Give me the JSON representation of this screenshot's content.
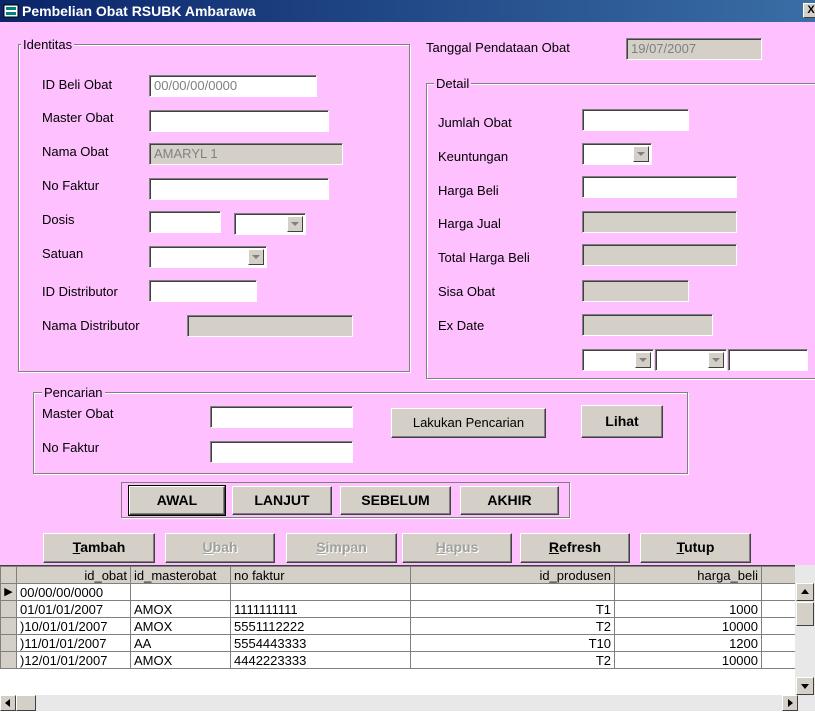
{
  "window": {
    "title": "Pembelian Obat RSUBK Ambarawa",
    "close_glyph": "X"
  },
  "identitas": {
    "group_label": "Identitas",
    "id_beli_label": "ID Beli Obat",
    "id_beli_value": "00/00/00/0000",
    "master_obat_label": "Master Obat",
    "master_obat_value": "",
    "nama_obat_label": "Nama Obat",
    "nama_obat_value": "AMARYL 1",
    "no_faktur_label": "No Faktur",
    "no_faktur_value": "",
    "dosis_label": "Dosis",
    "dosis_value": "",
    "dosis_unit": "",
    "satuan_label": "Satuan",
    "satuan_value": "",
    "id_distributor_label": "ID Distributor",
    "id_distributor_value": "",
    "nama_distributor_label": "Nama Distributor",
    "nama_distributor_value": ""
  },
  "tanggal": {
    "label": "Tanggal Pendataan Obat",
    "value": "19/07/2007"
  },
  "detail": {
    "group_label": "Detail",
    "jumlah_label": "Jumlah Obat",
    "jumlah_value": "",
    "keuntungan_label": "Keuntungan",
    "keuntungan_value": "",
    "harga_beli_label": "Harga Beli",
    "harga_beli_value": "",
    "harga_jual_label": "Harga Jual",
    "harga_jual_value": "",
    "total_label": "Total Harga Beli",
    "total_value": "",
    "sisa_label": "Sisa Obat",
    "sisa_value": "",
    "exdate_label": "Ex Date",
    "exdate_value": "",
    "exdate_day": "",
    "exdate_month": "",
    "exdate_year": ""
  },
  "pencarian": {
    "group_label": "Pencarian",
    "master_label": "Master Obat",
    "master_value": "",
    "faktur_label": "No Faktur",
    "faktur_value": "",
    "search_button": "Lakukan Pencarian",
    "lihat_button": "Lihat"
  },
  "nav": {
    "awal": "AWAL",
    "lanjut": "LANJUT",
    "sebelum": "SEBELUM",
    "akhir": "AKHIR"
  },
  "actions": {
    "tambah_first": "T",
    "tambah_rest": "ambah",
    "ubah_first": "U",
    "ubah_rest": "bah",
    "simpan_first": "S",
    "simpan_rest": "impan",
    "hapus_first": "H",
    "hapus_rest": "apus",
    "refresh_first": "R",
    "refresh_rest": "efresh",
    "tutup_first": "T",
    "tutup_rest": "utup"
  },
  "grid": {
    "columns": [
      "id_obat",
      "id_masterobat",
      "no faktur",
      "id_produsen",
      "harga_beli"
    ],
    "current_row_marker": "▶",
    "rows": [
      [
        "00/00/00/0000",
        "",
        "",
        "",
        ""
      ],
      [
        "01/01/01/2007",
        "AMOX",
        "1111111111",
        "T1",
        "1000"
      ],
      [
        ")10/01/01/2007",
        "AMOX",
        "5551112222",
        "T2",
        "10000"
      ],
      [
        ")11/01/01/2007",
        "AA",
        "5554443333",
        "T10",
        "1200"
      ],
      [
        ")12/01/01/2007",
        "AMOX",
        "4442223333",
        "T2",
        "10000"
      ]
    ]
  }
}
